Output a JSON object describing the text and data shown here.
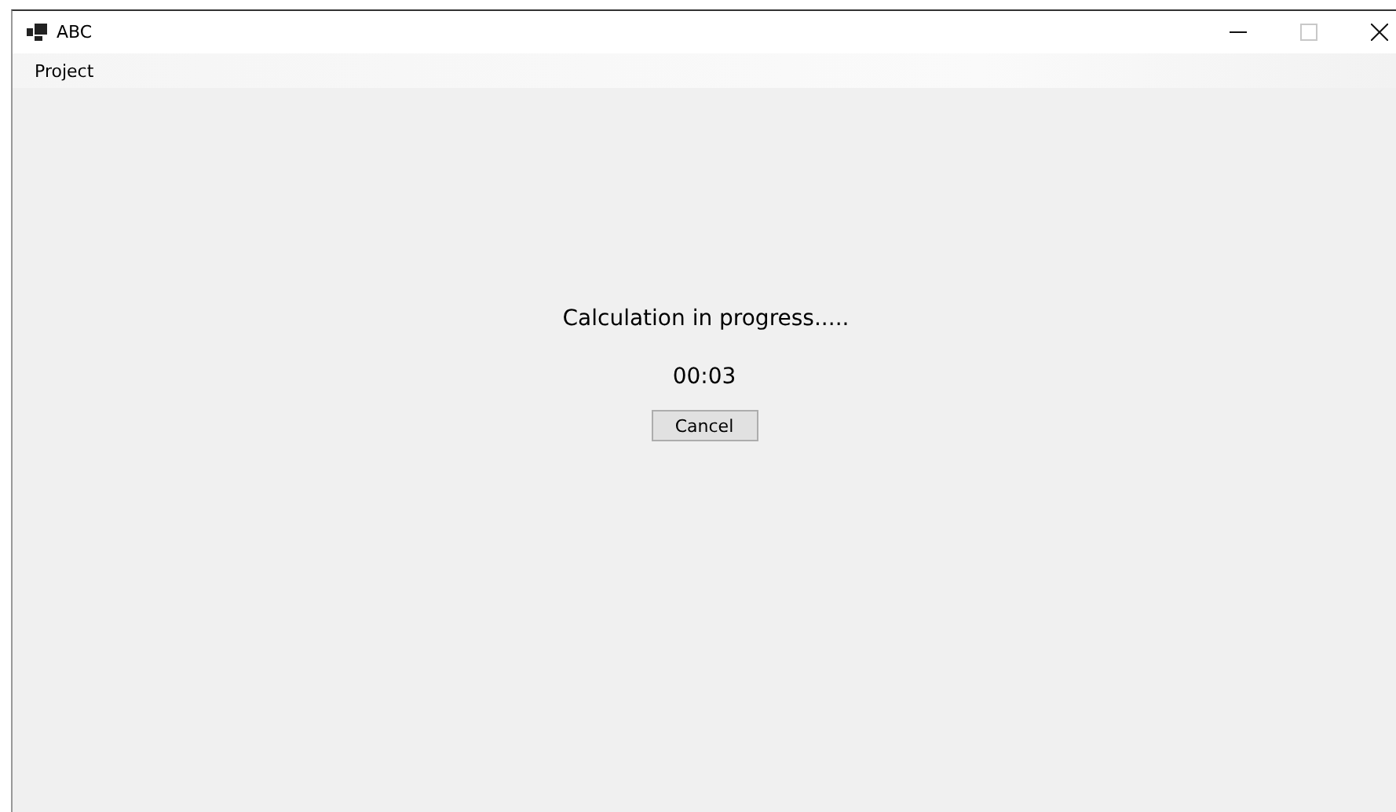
{
  "window": {
    "title": "ABC",
    "maximize_disabled": true
  },
  "menu": [
    {
      "label": "Project"
    }
  ],
  "status_text": "Calculation in progress.....",
  "elapsed": "00:03",
  "buttons": [
    {
      "label": "Cancel"
    }
  ]
}
